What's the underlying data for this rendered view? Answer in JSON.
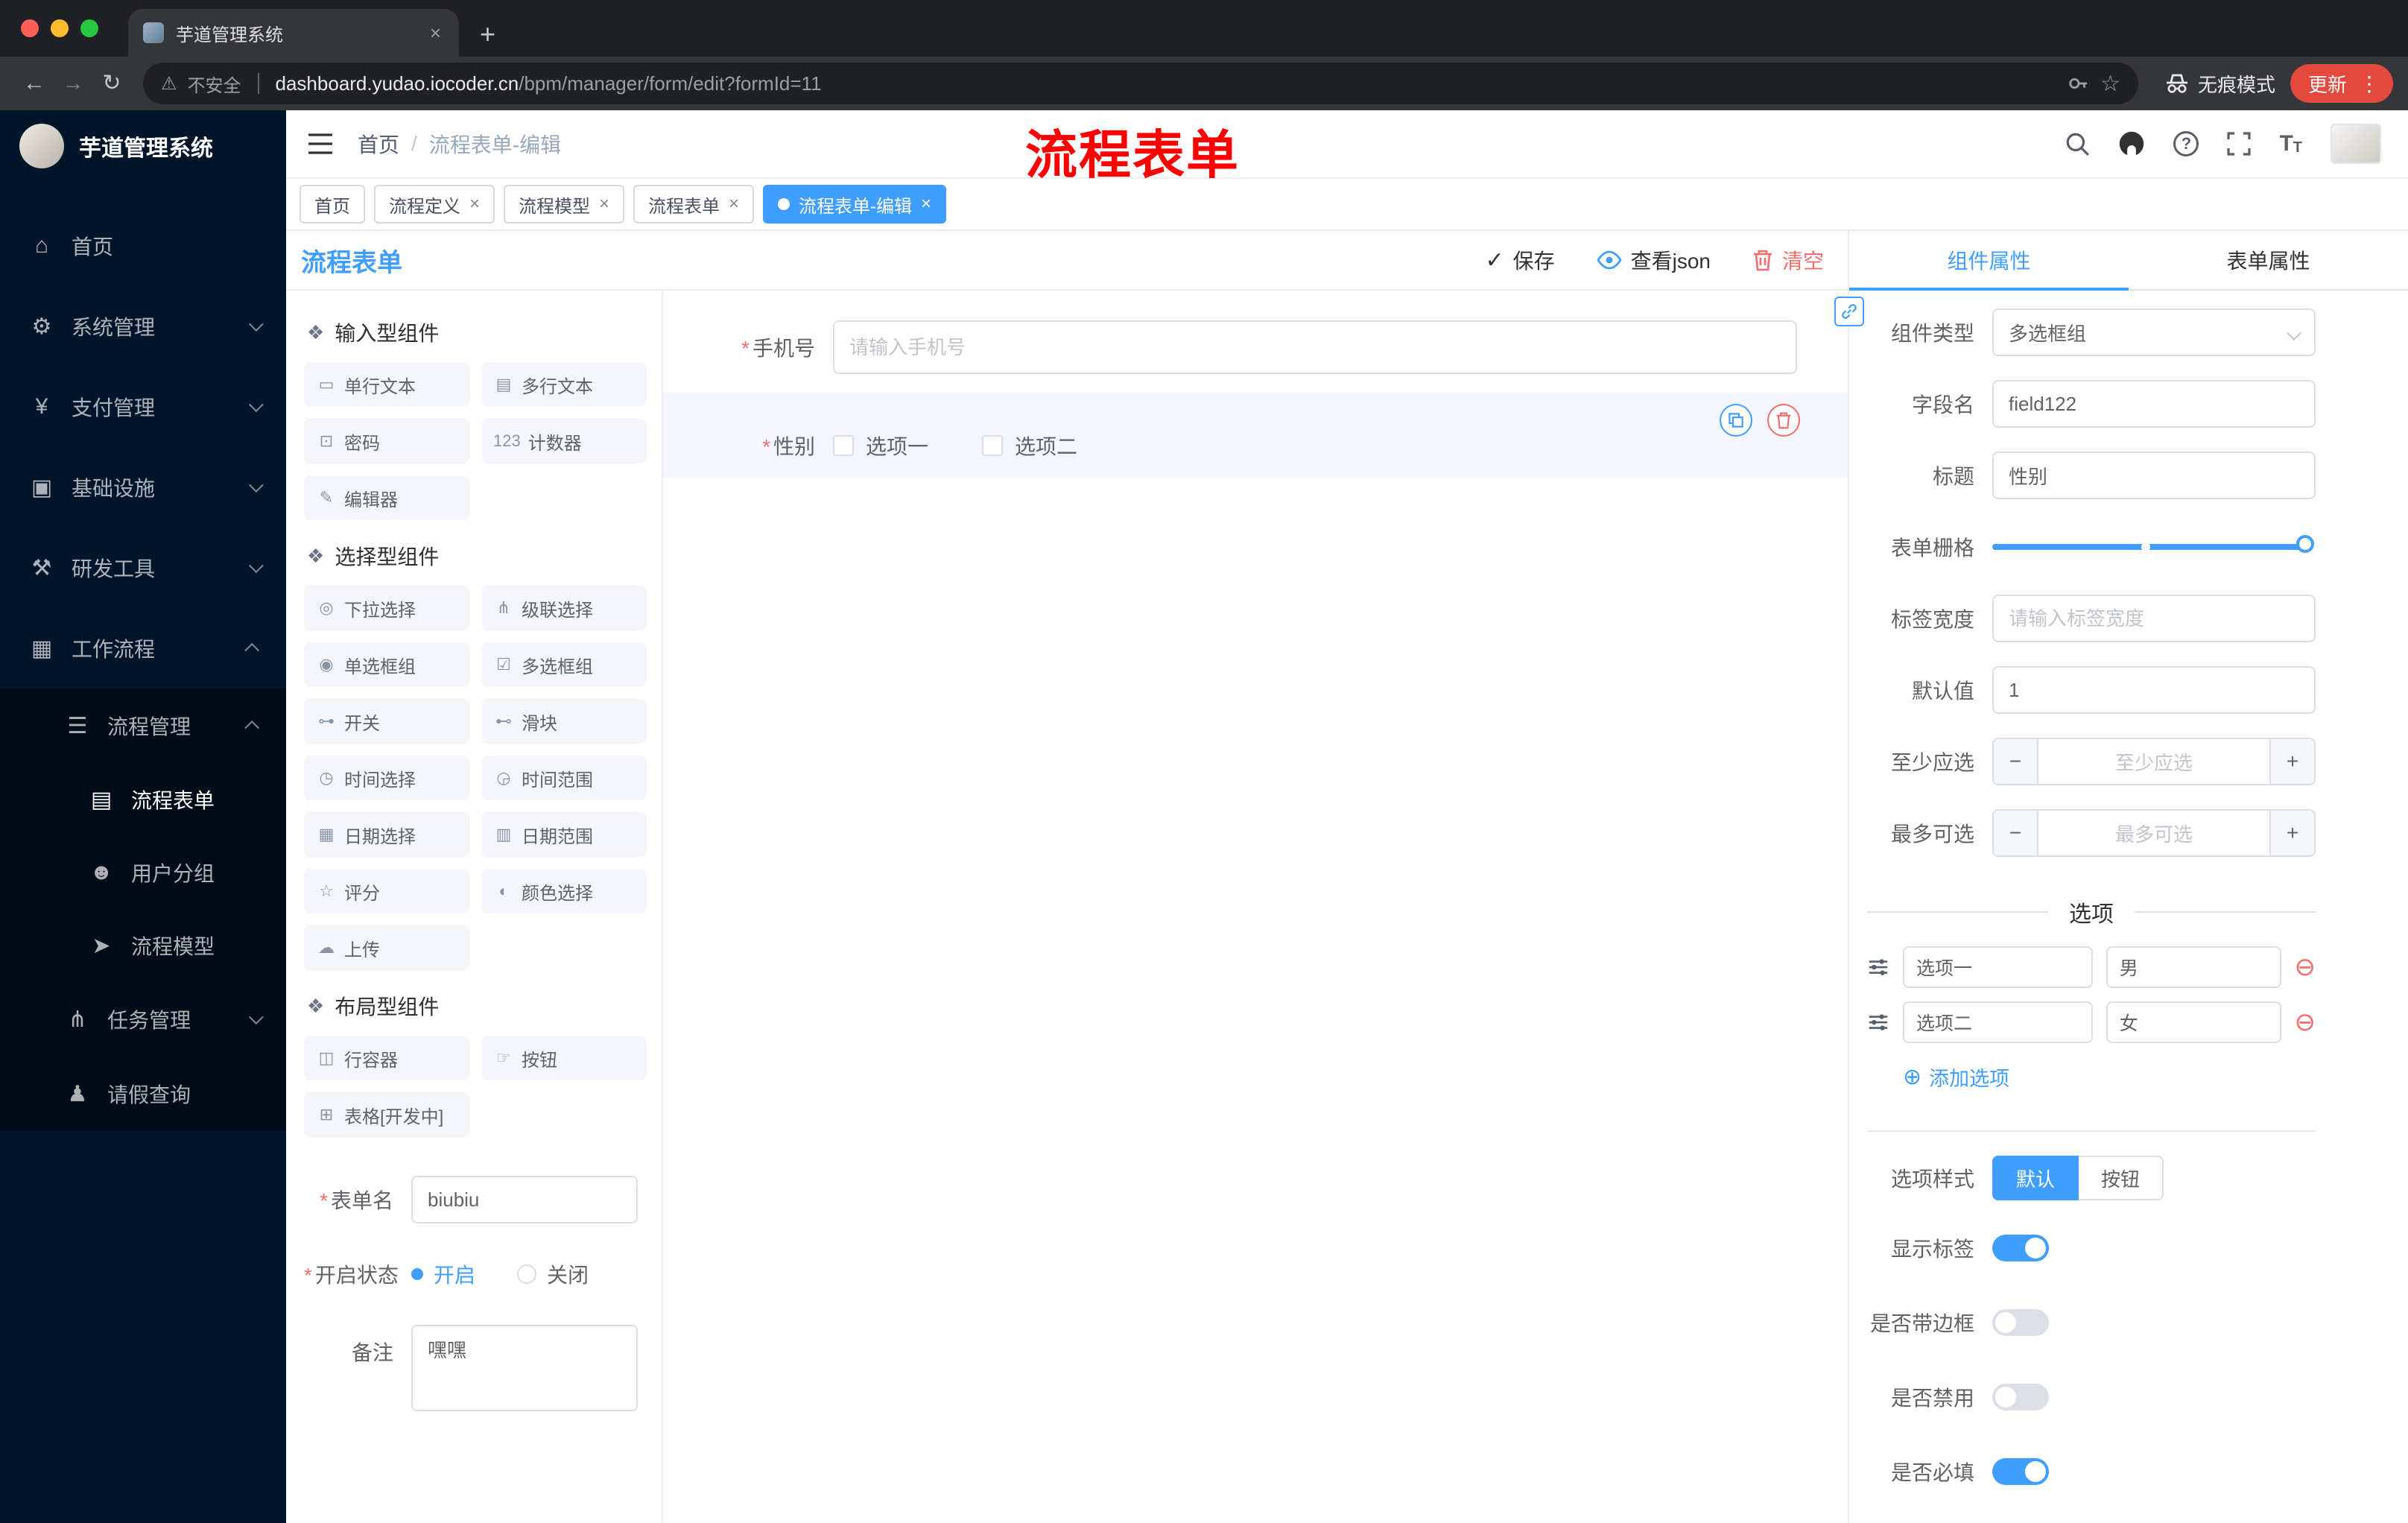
{
  "colors": {
    "primary": "#409eff",
    "danger": "#f56c6c",
    "sidebar_bg": "#001529",
    "chrome_bg": "#202124",
    "update_chip": "#e2493f",
    "annotation": "#ff0000"
  },
  "glyphs": {
    "close": "×",
    "plus": "+",
    "minus": "−",
    "back": "←",
    "forward": "→",
    "reload": "↻",
    "warning": "⚠",
    "star": "☆",
    "dots": "⋮",
    "help": "?",
    "t_big": "T",
    "t_small": "T",
    "check": "✓",
    "add_circle": "⊕",
    "remove_circle": "⊖",
    "required": "*",
    "breadcrumb_sep": "/"
  },
  "browser": {
    "tab_title": "芋道管理系统",
    "security_label": "不安全",
    "url_domain": "dashboard.yudao.iocoder.cn",
    "url_path": "/bpm/manager/form/edit?formId=11",
    "incognito_label": "无痕模式",
    "update_label": "更新"
  },
  "annotation": {
    "text": "流程表单"
  },
  "sidebar": {
    "title": "芋道管理系统",
    "menu": [
      {
        "label": "首页",
        "glyph": "⌂"
      },
      {
        "label": "系统管理",
        "glyph": "⚙"
      },
      {
        "label": "支付管理",
        "glyph": "¥"
      },
      {
        "label": "基础设施",
        "glyph": "▣"
      },
      {
        "label": "研发工具",
        "glyph": "⚒"
      },
      {
        "label": "工作流程",
        "glyph": "▦"
      }
    ],
    "submenu": [
      {
        "label": "流程管理",
        "glyph": "☰"
      },
      {
        "label": "流程表单",
        "glyph": "▤"
      },
      {
        "label": "用户分组",
        "glyph": "☻"
      },
      {
        "label": "流程模型",
        "glyph": "➤"
      },
      {
        "label": "任务管理",
        "glyph": "⋔"
      },
      {
        "label": "请假查询",
        "glyph": "♟"
      }
    ]
  },
  "header": {
    "breadcrumb_home": "首页",
    "breadcrumb_current": "流程表单-编辑"
  },
  "tags": [
    {
      "label": "首页"
    },
    {
      "label": "流程定义"
    },
    {
      "label": "流程模型"
    },
    {
      "label": "流程表单"
    },
    {
      "label": "流程表单-编辑"
    }
  ],
  "designer": {
    "title": "流程表单",
    "actions": {
      "save": "保存",
      "view_json": "查看json",
      "clear": "清空"
    },
    "groups": [
      {
        "title": "输入型组件",
        "items": [
          {
            "label": "单行文本",
            "glyph": "▭"
          },
          {
            "label": "多行文本",
            "glyph": "▤"
          },
          {
            "label": "密码",
            "glyph": "⊡"
          },
          {
            "label": "计数器",
            "glyph": "123"
          },
          {
            "label": "编辑器",
            "glyph": "✎"
          }
        ]
      },
      {
        "title": "选择型组件",
        "items": [
          {
            "label": "下拉选择",
            "glyph": "◎"
          },
          {
            "label": "级联选择",
            "glyph": "⋔"
          },
          {
            "label": "单选框组",
            "glyph": "◉"
          },
          {
            "label": "多选框组",
            "glyph": "☑"
          },
          {
            "label": "开关",
            "glyph": "⊶"
          },
          {
            "label": "滑块",
            "glyph": "⊷"
          },
          {
            "label": "时间选择",
            "glyph": "◷"
          },
          {
            "label": "时间范围",
            "glyph": "◶"
          },
          {
            "label": "日期选择",
            "glyph": "▦"
          },
          {
            "label": "日期范围",
            "glyph": "▥"
          },
          {
            "label": "评分",
            "glyph": "☆"
          },
          {
            "label": "颜色选择",
            "glyph": "◐"
          },
          {
            "label": "上传",
            "glyph": "☁"
          }
        ]
      },
      {
        "title": "布局型组件",
        "items": [
          {
            "label": "行容器",
            "glyph": "◫"
          },
          {
            "label": "按钮",
            "glyph": "☞"
          },
          {
            "label": "表格[开发中]",
            "glyph": "⊞"
          }
        ]
      }
    ],
    "meta": {
      "name_label": "表单名",
      "name_value": "biubiu",
      "status_label": "开启状态",
      "status_on": "开启",
      "status_off": "关闭",
      "remark_label": "备注",
      "remark_value": "嘿嘿"
    },
    "canvas": {
      "phone_label": "手机号",
      "phone_placeholder": "请输入手机号",
      "gender_label": "性别",
      "gender_opt1": "选项一",
      "gender_opt2": "选项二"
    }
  },
  "props": {
    "tab_component": "组件属性",
    "tab_form": "表单属性",
    "component_type_label": "组件类型",
    "component_type_value": "多选框组",
    "field_label": "字段名",
    "field_value": "field122",
    "title_label": "标题",
    "title_value": "性别",
    "grid_label": "表单栅格",
    "label_width_label": "标签宽度",
    "label_width_placeholder": "请输入标签宽度",
    "default_label": "默认值",
    "default_value": "1",
    "min_label": "至少应选",
    "min_placeholder": "至少应选",
    "max_label": "最多可选",
    "max_placeholder": "最多可选",
    "options_title": "选项",
    "options": [
      {
        "label": "选项一",
        "value": "男"
      },
      {
        "label": "选项二",
        "value": "女"
      }
    ],
    "add_option": "添加选项",
    "style_label": "选项样式",
    "style_default": "默认",
    "style_button": "按钮",
    "switches": [
      {
        "label": "显示标签",
        "on": true
      },
      {
        "label": "是否带边框",
        "on": false
      },
      {
        "label": "是否禁用",
        "on": false
      },
      {
        "label": "是否必填",
        "on": true
      }
    ]
  }
}
